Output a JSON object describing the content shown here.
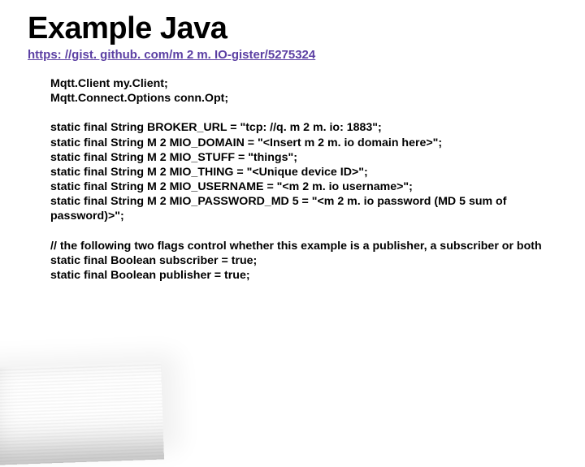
{
  "title": "Example Java",
  "url": "https: //gist. github. com/m 2 m. IO-gister/5275324",
  "decl1": "Mqtt.Client my.Client;",
  "decl2": "Mqtt.Connect.Options conn.Opt;",
  "s1": "static final String BROKER_URL = \"tcp: //q. m 2 m. io: 1883\";",
  "s2": "static final String M 2 MIO_DOMAIN = \"<Insert m 2 m. io domain here>\";",
  "s3": "static final String M 2 MIO_STUFF = \"things\";",
  "s4": "static final String M 2 MIO_THING = \"<Unique device ID>\";",
  "s5": "static final String M 2 MIO_USERNAME = \"<m 2 m. io username>\";",
  "s6": "static final String M 2 MIO_PASSWORD_MD 5 = \"<m 2 m. io password (MD 5 sum of password)>\";",
  "c1": "// the following two flags control whether this example is a publisher, a subscriber or both",
  "c2": "static final Boolean subscriber = true;",
  "c3": "static final Boolean publisher = true;"
}
